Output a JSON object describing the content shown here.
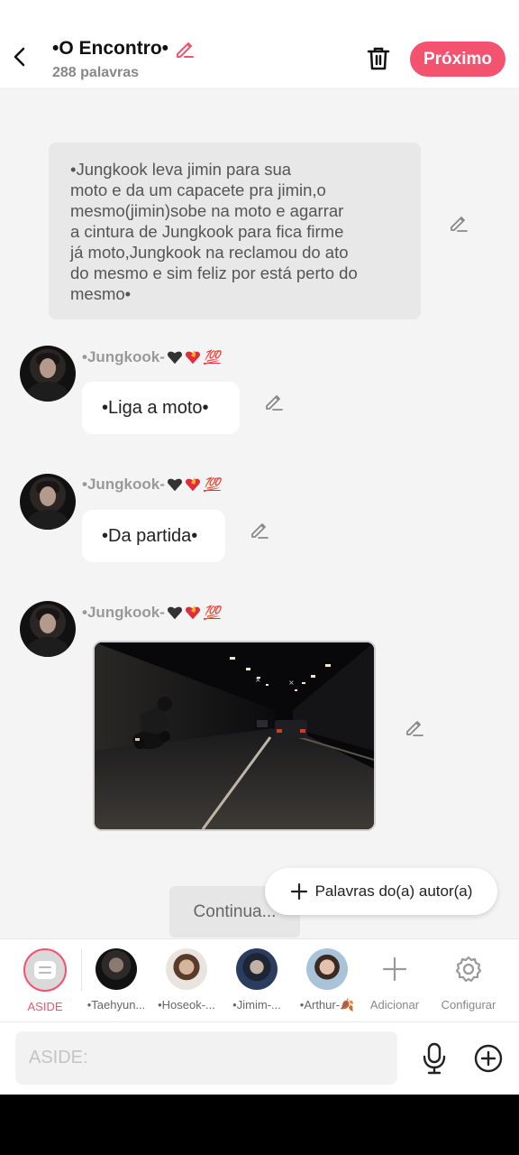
{
  "header": {
    "title": "•O Encontro•",
    "word_count": "288 palavras",
    "next_label": "Próximo",
    "accent": "#f3536e"
  },
  "chat": {
    "narration": "•Jungkook leva jimin para sua\nmoto e da um capacete pra jimin,o\nmesmo(jimin)sobe na moto e agarrar\na cintura de Jungkook para fica firme\njá moto,Jungkook na reclamou do ato\ndo mesmo e sim feliz por está perto do\nmesmo•",
    "messages": [
      {
        "speaker": "•Jungkook-",
        "emoji": "💯",
        "text": "•Liga a moto•"
      },
      {
        "speaker": "•Jungkook-",
        "emoji": "💯",
        "text": "•Da partida•"
      },
      {
        "speaker": "•Jungkook-",
        "emoji": "💯",
        "image": "motorcycle-tunnel-image"
      }
    ],
    "continue_label": "Continua...",
    "author_words_label": "Palavras do(a) autor(a)"
  },
  "characters": [
    {
      "label": "ASIDE",
      "active": true
    },
    {
      "label": "•Taehyun..."
    },
    {
      "label": "•Hoseok-..."
    },
    {
      "label": "•Jimim-..."
    },
    {
      "label": "•Arthur-🍂"
    }
  ],
  "tools": {
    "add_label": "Adicionar",
    "settings_label": "Configurar"
  },
  "input": {
    "placeholder": "ASIDE:"
  }
}
